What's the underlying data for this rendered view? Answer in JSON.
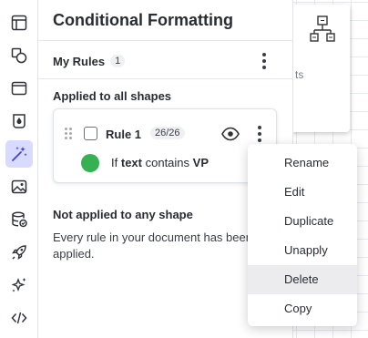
{
  "toolbar": {
    "items": [
      {
        "name": "panels-icon"
      },
      {
        "name": "shapes-icon"
      },
      {
        "name": "page-settings-icon"
      },
      {
        "name": "theme-icon"
      },
      {
        "name": "magic-wand-icon",
        "active": true
      },
      {
        "name": "image-icon"
      },
      {
        "name": "data-linking-icon"
      },
      {
        "name": "rocket-icon"
      },
      {
        "name": "sparkle-icon"
      },
      {
        "name": "code-icon"
      }
    ]
  },
  "canvas": {
    "shape_text_fragment": "ts"
  },
  "panel": {
    "title": "Conditional Formatting",
    "my_rules": {
      "label": "My Rules",
      "count": "1"
    },
    "applied_heading": "Applied to all shapes",
    "rule": {
      "name": "Rule 1",
      "badge": "26/26",
      "color": "#35b152",
      "condition_prefix": "If",
      "condition_field": "text",
      "condition_op": "contains",
      "condition_value": "VP"
    },
    "not_applied_heading": "Not applied to any shape",
    "not_applied_text": "Every rule in your document has been applied."
  },
  "context_menu": {
    "items": [
      "Rename",
      "Edit",
      "Duplicate",
      "Unapply",
      "Delete",
      "Copy"
    ],
    "hovered": "Delete"
  },
  "colors": {
    "accent_active": "#d8dbff",
    "rule_color": "#35b152"
  }
}
